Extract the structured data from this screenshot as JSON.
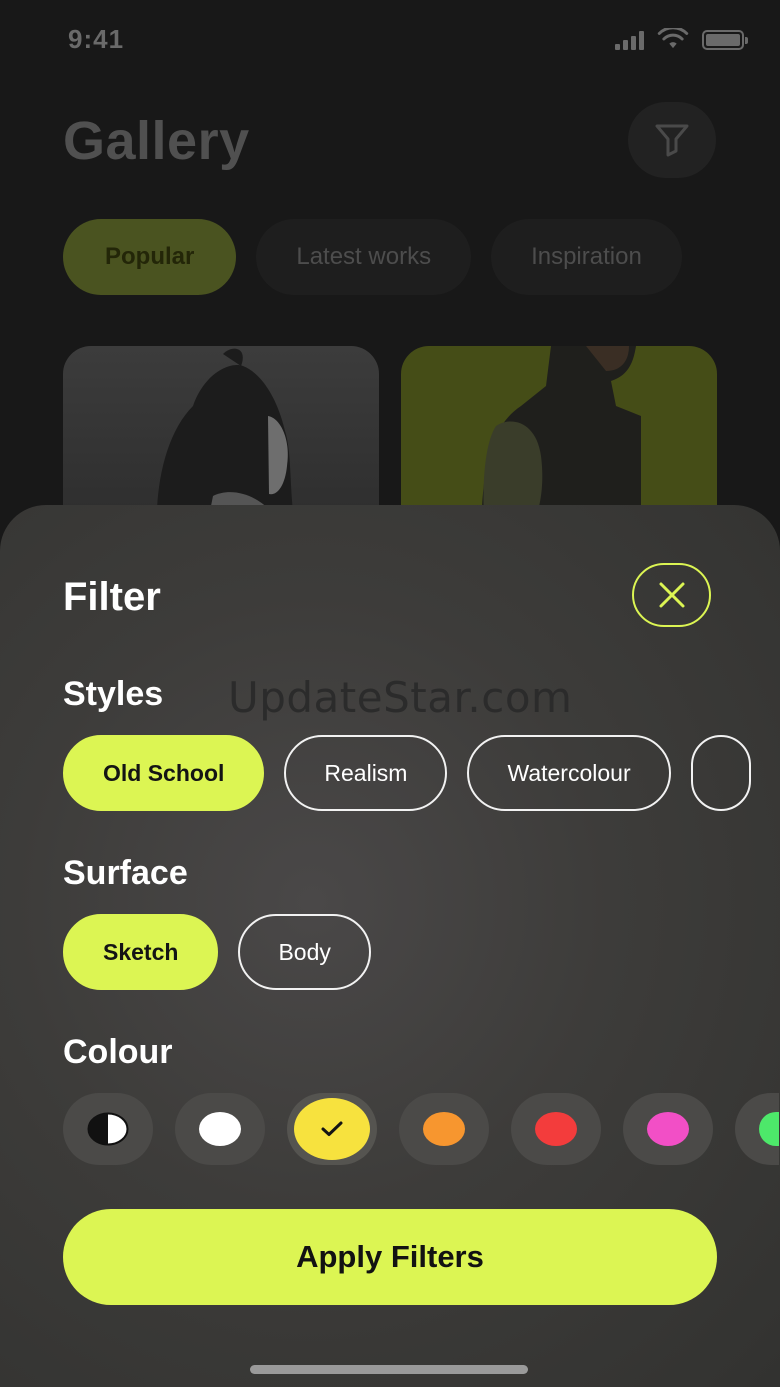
{
  "status": {
    "time": "9:41"
  },
  "gallery": {
    "title": "Gallery",
    "tabs": [
      {
        "label": "Popular",
        "active": true
      },
      {
        "label": "Latest works",
        "active": false
      },
      {
        "label": "Inspiration",
        "active": false
      }
    ]
  },
  "filter": {
    "title": "Filter",
    "watermark": "UpdateStar.com",
    "styles": {
      "label": "Styles",
      "options": [
        {
          "label": "Old School",
          "selected": true
        },
        {
          "label": "Realism",
          "selected": false
        },
        {
          "label": "Watercolour",
          "selected": false
        },
        {
          "label": "",
          "selected": false
        }
      ]
    },
    "surface": {
      "label": "Surface",
      "options": [
        {
          "label": "Sketch",
          "selected": true
        },
        {
          "label": "Body",
          "selected": false
        }
      ]
    },
    "colour": {
      "label": "Colour",
      "swatches": [
        {
          "name": "black-white",
          "selected": false
        },
        {
          "name": "white",
          "color": "#ffffff",
          "selected": false
        },
        {
          "name": "yellow",
          "color": "#f7e23e",
          "selected": true
        },
        {
          "name": "orange",
          "color": "#f7962f",
          "selected": false
        },
        {
          "name": "red",
          "color": "#f33c3c",
          "selected": false
        },
        {
          "name": "pink",
          "color": "#f24fc6",
          "selected": false
        },
        {
          "name": "green",
          "color": "#4de86a",
          "selected": false
        }
      ]
    },
    "apply_label": "Apply Filters"
  },
  "colors": {
    "accent": "#dcf553",
    "sheet": "#3d3c3a",
    "background": "#181818"
  }
}
